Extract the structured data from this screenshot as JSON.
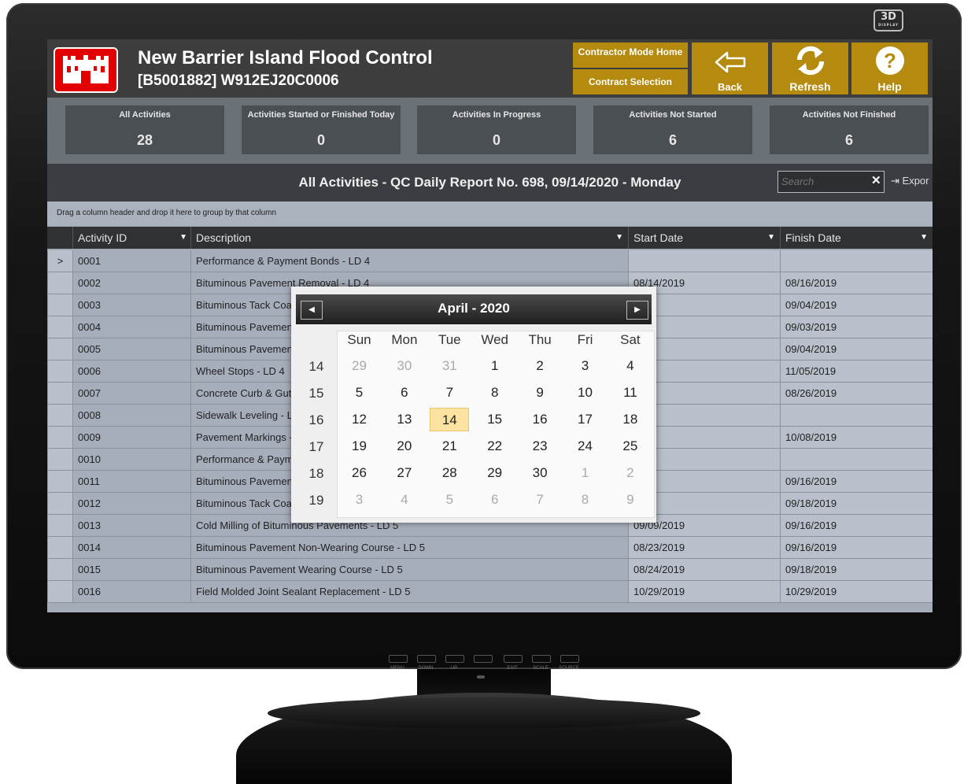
{
  "monitor": {
    "badge_main": "3D",
    "badge_sub": "DISPLAY",
    "buttons": [
      "MENU",
      "DOWN",
      "UP",
      "",
      "EXIT",
      "SCALE",
      "SOURCE"
    ]
  },
  "header": {
    "title": "New Barrier Island Flood Control",
    "subtitle": "[B5001882] W912EJ20C0006",
    "contractor_mode_home": "Contractor Mode Home",
    "contract_selection": "Contract Selection",
    "back": "Back",
    "refresh": "Refresh",
    "help": "Help"
  },
  "stats": [
    {
      "label": "All Activities",
      "value": "28"
    },
    {
      "label": "Activities Started or Finished Today",
      "value": "0"
    },
    {
      "label": "Activities In Progress",
      "value": "0"
    },
    {
      "label": "Activities Not Started",
      "value": "6"
    },
    {
      "label": "Activities Not Finished",
      "value": "6"
    }
  ],
  "report": {
    "title": "All Activities - QC Daily Report No. 698, 09/14/2020 - Monday",
    "search_placeholder": "Search",
    "search_clear": "✕",
    "export": "Expor"
  },
  "grid": {
    "group_hint": "Drag a column header and drop it here to group by that column",
    "columns": [
      "Activity ID",
      "Description",
      "Start Date",
      "Finish Date"
    ],
    "rows": [
      {
        "id": "0001",
        "desc": "Performance & Payment Bonds - LD 4",
        "start": "",
        "finish": ""
      },
      {
        "id": "0002",
        "desc": "Bituminous Pavement Removal - LD 4",
        "start": "08/14/2019",
        "finish": "08/16/2019"
      },
      {
        "id": "0003",
        "desc": "Bituminous Tack Coat - LD 4",
        "start": "2019",
        "finish": "09/04/2019"
      },
      {
        "id": "0004",
        "desc": " Bituminous Pavement Non-Wearing Course - LD 4",
        "start": "2019",
        "finish": "09/03/2019"
      },
      {
        "id": "0005",
        "desc": "Bituminous Pavement Wearing Course - LD 4",
        "start": "2019",
        "finish": "09/04/2019"
      },
      {
        "id": "0006",
        "desc": "Wheel Stops - LD 4",
        "start": "2019",
        "finish": "11/05/2019"
      },
      {
        "id": "0007",
        "desc": "Concrete Curb & Gutter - LD 4",
        "start": "2019",
        "finish": "08/26/2019"
      },
      {
        "id": "0008",
        "desc": "Sidewalk Leveling - LD 4",
        "start": "",
        "finish": ""
      },
      {
        "id": "0009",
        "desc": "Pavement Markings - LD 4",
        "start": "2019",
        "finish": "10/08/2019"
      },
      {
        "id": "0010",
        "desc": "Performance & Payment Bonds - LD 5",
        "start": "",
        "finish": ""
      },
      {
        "id": "0011",
        "desc": "Bituminous Pavement Removal - LD 5",
        "start": "2019",
        "finish": "09/16/2019"
      },
      {
        "id": "0012",
        "desc": "Bituminous Tack Coat - LD 5",
        "start": "2019",
        "finish": "09/18/2019"
      },
      {
        "id": "0013",
        "desc": "Cold Milling of Bituminous Pavements - LD 5",
        "start": "09/09/2019",
        "finish": "09/16/2019"
      },
      {
        "id": "0014",
        "desc": "Bituminous Pavement Non-Wearing Course - LD 5",
        "start": "08/23/2019",
        "finish": "09/16/2019"
      },
      {
        "id": "0015",
        "desc": "Bituminous Pavement Wearing Course - LD 5",
        "start": "08/24/2019",
        "finish": "09/18/2019"
      },
      {
        "id": "0016",
        "desc": "Field Molded Joint Sealant Replacement - LD 5",
        "start": "10/29/2019",
        "finish": "10/29/2019"
      }
    ],
    "row_indicator": ">"
  },
  "calendar": {
    "title": "April - 2020",
    "prev": "◀",
    "next": "▶",
    "days_of_week": [
      "Sun",
      "Mon",
      "Tue",
      "Wed",
      "Thu",
      "Fri",
      "Sat"
    ],
    "week_numbers": [
      "14",
      "15",
      "16",
      "17",
      "18",
      "19"
    ],
    "weeks": [
      [
        "29",
        "30",
        "31",
        "1",
        "2",
        "3",
        "4"
      ],
      [
        "5",
        "6",
        "7",
        "8",
        "9",
        "10",
        "11"
      ],
      [
        "12",
        "13",
        "14",
        "15",
        "16",
        "17",
        "18"
      ],
      [
        "19",
        "20",
        "21",
        "22",
        "23",
        "24",
        "25"
      ],
      [
        "26",
        "27",
        "28",
        "29",
        "30",
        "1",
        "2"
      ],
      [
        "3",
        "4",
        "5",
        "6",
        "7",
        "8",
        "9"
      ]
    ],
    "selected": "14"
  },
  "colors": {
    "gold_button": "#b48a0f",
    "logo_red": "#e30000",
    "header_bg": "#3d3d3d",
    "today_highlight": "#fde3a1"
  }
}
